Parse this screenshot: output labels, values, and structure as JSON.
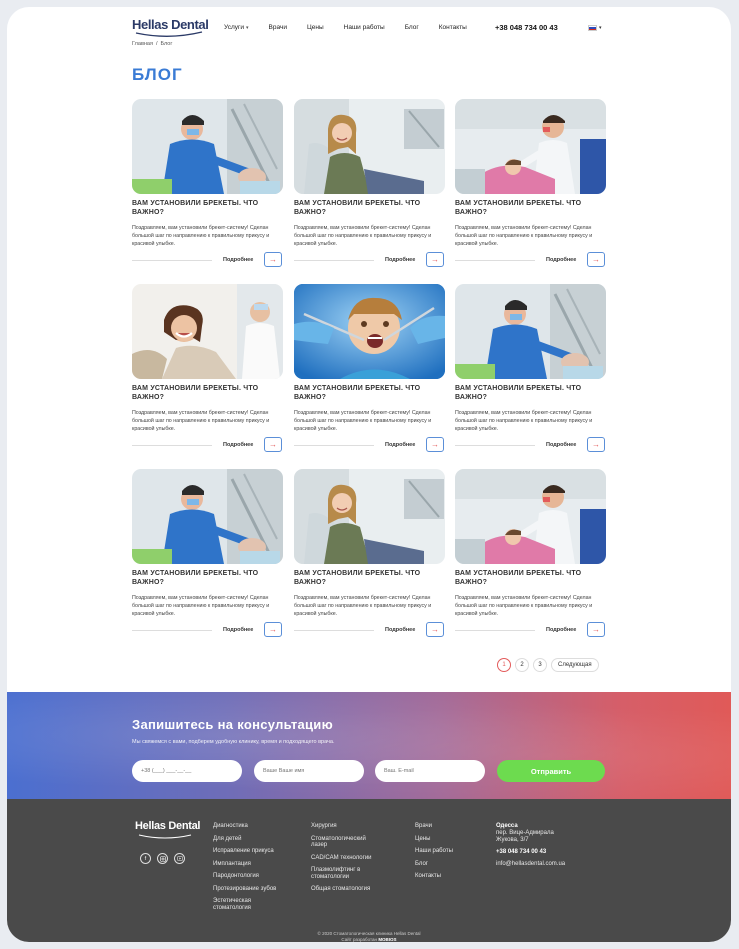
{
  "header": {
    "logo": "Hellas Dental",
    "nav": [
      {
        "label": "Услуги",
        "dropdown": true
      },
      {
        "label": "Врачи"
      },
      {
        "label": "Цены"
      },
      {
        "label": "Наши работы"
      },
      {
        "label": "Блог"
      },
      {
        "label": "Контакты"
      }
    ],
    "phone": "+38 048 734 00 43",
    "lang_flag_colors": [
      "#ffffff",
      "#2d4bbd",
      "#d52b1e"
    ]
  },
  "breadcrumb": {
    "home": "Главная",
    "separator": "/",
    "current": "Блог"
  },
  "page_title": "БЛОГ",
  "posts": [
    {
      "title": "ВАМ УСТАНОВИЛИ БРЕКЕТЫ. ЧТО ВАЖНО?",
      "excerpt": "Поздравляем, вам установили брекет-систему! Сделан большой шаг по направлению к правильному прикусу и красивой улыбке.",
      "more": "Подробнее",
      "image": "dentist-treating-patient"
    },
    {
      "title": "ВАМ УСТАНОВИЛИ БРЕКЕТЫ. ЧТО ВАЖНО?",
      "excerpt": "Поздравляем, вам установили брекет-систему! Сделан большой шаг по направлению к правильному прикусу и красивой улыбке.",
      "more": "Подробнее",
      "image": "smiling-woman-dental-chair"
    },
    {
      "title": "ВАМ УСТАНОВИЛИ БРЕКЕТЫ. ЧТО ВАЖНО?",
      "excerpt": "Поздравляем, вам установили брекет-систему! Сделан большой шаг по направлению к правильному прикусу и красивой улыбке.",
      "more": "Подробнее",
      "image": "dentist-with-girl-patient"
    },
    {
      "title": "ВАМ УСТАНОВИЛИ БРЕКЕТЫ. ЧТО ВАЖНО?",
      "excerpt": "Поздравляем, вам установили брекет-систему! Сделан большой шаг по направлению к правильному прикусу и красивой улыбке.",
      "more": "Подробнее",
      "image": "smiling-woman-and-dentist"
    },
    {
      "title": "ВАМ УСТАНОВИЛИ БРЕКЕТЫ. ЧТО ВАЖНО?",
      "excerpt": "Поздравляем, вам установили брекет-систему! Сделан большой шаг по направлению к правильному прикусу и красивой улыбке.",
      "more": "Подробнее",
      "image": "boy-dental-checkup"
    },
    {
      "title": "ВАМ УСТАНОВИЛИ БРЕКЕТЫ. ЧТО ВАЖНО?",
      "excerpt": "Поздравляем, вам установили брекет-систему! Сделан большой шаг по направлению к правильному прикусу и красивой улыбке.",
      "more": "Подробнее",
      "image": "dentist-treating-patient"
    },
    {
      "title": "ВАМ УСТАНОВИЛИ БРЕКЕТЫ. ЧТО ВАЖНО?",
      "excerpt": "Поздравляем, вам установили брекет-систему! Сделан большой шаг по направлению к правильному прикусу и красивой улыбке.",
      "more": "Подробнее",
      "image": "dentist-treating-patient"
    },
    {
      "title": "ВАМ УСТАНОВИЛИ БРЕКЕТЫ. ЧТО ВАЖНО?",
      "excerpt": "Поздравляем, вам установили брекет-систему! Сделан большой шаг по направлению к правильному прикусу и красивой улыбке.",
      "more": "Подробнее",
      "image": "smiling-woman-dental-chair"
    },
    {
      "title": "ВАМ УСТАНОВИЛИ БРЕКЕТЫ. ЧТО ВАЖНО?",
      "excerpt": "Поздравляем, вам установили брекет-систему! Сделан большой шаг по направлению к правильному прикусу и красивой улыбке.",
      "more": "Подробнее",
      "image": "dentist-with-girl-patient"
    }
  ],
  "pagination": {
    "pages": [
      "1",
      "2",
      "3"
    ],
    "current": "1",
    "next": "Следующая"
  },
  "cta": {
    "title": "Запишитесь на консультацию",
    "subtitle": "Мы свяжемся с вами, подберем удобную клинику, время и подходящего врача.",
    "phone_placeholder": "+38 (___) ___-__-__",
    "name_placeholder": "Ваше Ваше имя",
    "email_placeholder": "Ваш. E-mail",
    "button": "Отправить",
    "button_color": "#6ddb4f"
  },
  "footer": {
    "logo": "Hellas Dental",
    "social": [
      "facebook-icon",
      "instagram-icon",
      "youtube-icon"
    ],
    "col1": [
      "Диагностика",
      "Для детей",
      "Исправление прикуса",
      "Имплантация",
      "Пародонтология",
      "Протезирование зубов",
      "Эстетическая стоматология"
    ],
    "col2": [
      "Хирургия",
      "Стоматологический лазер",
      "CAD/CAM технологии",
      "Плазмолифтинг в стоматологии",
      "Общая стоматология"
    ],
    "col3": [
      "Врачи",
      "Цены",
      "Наши работы",
      "Блог",
      "Контакты"
    ],
    "contact": {
      "city": "Одесса",
      "address": "пер. Вице-Адмирала Жукова, 3/7",
      "phone": "+38 048 734 00 43",
      "email": "info@hellasdental.com.ua"
    },
    "copyright": "© 2020 Стоматологическая клиника Hellas Dental",
    "developer_prefix": "Сайт разработан",
    "developer": "MOBIOS"
  },
  "colors": {
    "accent": "#3a7bd5",
    "arrow": "#e35b5b",
    "footer_bg": "#4a4a4a"
  }
}
